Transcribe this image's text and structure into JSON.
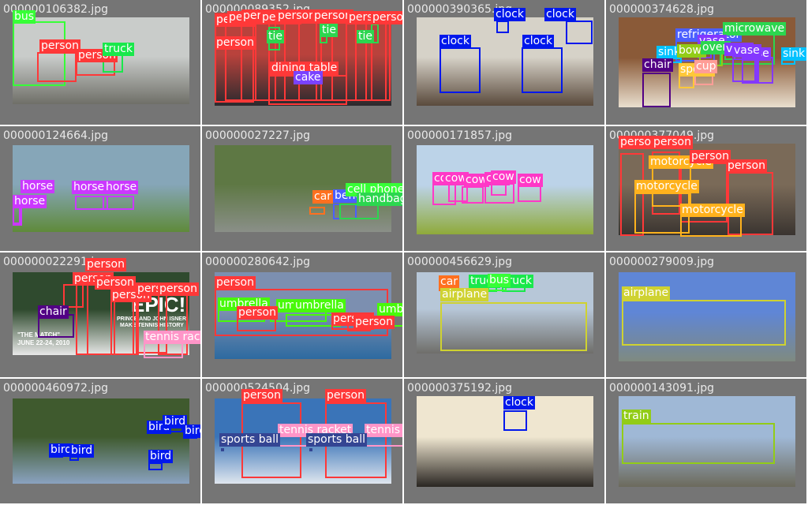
{
  "grid": {
    "cells": [
      {
        "filename": "000000106382.jpg",
        "photo_colors": [
          "#c9ccca",
          "#6f6f68"
        ],
        "detections": [
          {
            "label": "bus",
            "color": "#37ff37"
          },
          {
            "label": "person",
            "color": "#ff3838"
          },
          {
            "label": "person",
            "color": "#ff3838"
          },
          {
            "label": "truck",
            "color": "#19e84b"
          }
        ]
      },
      {
        "filename": "000000089352.jpg",
        "photo_colors": [
          "#b9423c",
          "#2a2a2e"
        ],
        "detections": [
          {
            "label": "person",
            "color": "#ff3838"
          },
          {
            "label": "person",
            "color": "#ff3838"
          },
          {
            "label": "person",
            "color": "#ff3838"
          },
          {
            "label": "person",
            "color": "#ff3838"
          },
          {
            "label": "person",
            "color": "#ff3838"
          },
          {
            "label": "person",
            "color": "#ff3838"
          },
          {
            "label": "person",
            "color": "#ff3838"
          },
          {
            "label": "person",
            "color": "#ff3838"
          },
          {
            "label": "person",
            "color": "#ff3838"
          },
          {
            "label": "tie",
            "color": "#2cd64f"
          },
          {
            "label": "tie",
            "color": "#2cd64f"
          },
          {
            "label": "tie",
            "color": "#2cd64f"
          },
          {
            "label": "dining table",
            "color": "#ff3838"
          },
          {
            "label": "cake",
            "color": "#7a42ff"
          }
        ]
      },
      {
        "filename": "000000390365.jpg",
        "photo_colors": [
          "#d6d2c8",
          "#5a4a3c"
        ],
        "detections": [
          {
            "label": "clock",
            "color": "#0018ec"
          },
          {
            "label": "clock",
            "color": "#0018ec"
          },
          {
            "label": "clock",
            "color": "#0018ec"
          },
          {
            "label": "clock",
            "color": "#0018ec"
          }
        ]
      },
      {
        "filename": "000000374628.jpg",
        "photo_colors": [
          "#8a5a38",
          "#e9dfcf"
        ],
        "detections": [
          {
            "label": "refrigerator",
            "color": "#4b5fff"
          },
          {
            "label": "microwave",
            "color": "#2cd64f"
          },
          {
            "label": "vase",
            "color": "#8438ff"
          },
          {
            "label": "sink",
            "color": "#00c2ff"
          },
          {
            "label": "bowl",
            "color": "#92cc17"
          },
          {
            "label": "oven",
            "color": "#2cd64f"
          },
          {
            "label": "vase",
            "color": "#8438ff"
          },
          {
            "label": "vase",
            "color": "#8438ff"
          },
          {
            "label": "chair",
            "color": "#520085"
          },
          {
            "label": "spoon",
            "color": "#ffc839"
          },
          {
            "label": "cup",
            "color": "#ff9d97"
          },
          {
            "label": "vase",
            "color": "#8438ff"
          },
          {
            "label": "sink",
            "color": "#00c2ff"
          }
        ]
      },
      {
        "filename": "000000124664.jpg",
        "photo_colors": [
          "#86a6b8",
          "#5f8a3a"
        ],
        "detections": [
          {
            "label": "horse",
            "color": "#cb38ff"
          },
          {
            "label": "horse",
            "color": "#cb38ff"
          },
          {
            "label": "horse",
            "color": "#cb38ff"
          },
          {
            "label": "horse",
            "color": "#cb38ff"
          }
        ]
      },
      {
        "filename": "000000027227.jpg",
        "photo_colors": [
          "#5e7844",
          "#8a8f88"
        ],
        "detections": [
          {
            "label": "car",
            "color": "#ff701f"
          },
          {
            "label": "bench",
            "color": "#4b5fff"
          },
          {
            "label": "cell phone",
            "color": "#37ff37"
          },
          {
            "label": "handbag",
            "color": "#2cd64f"
          }
        ]
      },
      {
        "filename": "000000171857.jpg",
        "photo_colors": [
          "#bcd3e8",
          "#8faa3a"
        ],
        "detections": [
          {
            "label": "cow",
            "color": "#ff38c7"
          },
          {
            "label": "cow",
            "color": "#ff38c7"
          },
          {
            "label": "cow",
            "color": "#ff38c7"
          },
          {
            "label": "cow",
            "color": "#ff38c7"
          },
          {
            "label": "cow",
            "color": "#ff38c7"
          },
          {
            "label": "cow",
            "color": "#ff38c7"
          }
        ]
      },
      {
        "filename": "000000377049.jpg",
        "photo_colors": [
          "#7a6a58",
          "#3a3430"
        ],
        "detections": [
          {
            "label": "person",
            "color": "#ff3838"
          },
          {
            "label": "person",
            "color": "#ff3838"
          },
          {
            "label": "motorcycle",
            "color": "#ffb21d"
          },
          {
            "label": "person",
            "color": "#ff3838"
          },
          {
            "label": "person",
            "color": "#ff3838"
          },
          {
            "label": "motorcycle",
            "color": "#ffb21d"
          },
          {
            "label": "motorcycle",
            "color": "#ffb21d"
          }
        ]
      },
      {
        "filename": "000000022291.jpg",
        "photo_colors": [
          "#2f4a2e",
          "#e8e8e8"
        ],
        "overlay_text": [
          "EPIC!",
          "PRINCE AND JOHN ISNER",
          "MAKE TENNIS HISTORY",
          "\"THE MATCH\"",
          "JUNE 22-24, 2010"
        ],
        "detections": [
          {
            "label": "person",
            "color": "#ff3838"
          },
          {
            "label": "person",
            "color": "#ff3838"
          },
          {
            "label": "person",
            "color": "#ff3838"
          },
          {
            "label": "person",
            "color": "#ff3838"
          },
          {
            "label": "person",
            "color": "#ff3838"
          },
          {
            "label": "person",
            "color": "#ff3838"
          },
          {
            "label": "chair",
            "color": "#520085"
          },
          {
            "label": "tennis racket",
            "color": "#ff95c8"
          }
        ]
      },
      {
        "filename": "000000280642.jpg",
        "photo_colors": [
          "#7c8fb0",
          "#2d6aa0"
        ],
        "detections": [
          {
            "label": "person",
            "color": "#ff3838"
          },
          {
            "label": "umbrella",
            "color": "#48f90a"
          },
          {
            "label": "umbrella",
            "color": "#48f90a"
          },
          {
            "label": "person",
            "color": "#ff3838"
          },
          {
            "label": "umbrella",
            "color": "#48f90a"
          },
          {
            "label": "umbrella",
            "color": "#48f90a"
          },
          {
            "label": "person",
            "color": "#ff3838"
          },
          {
            "label": "person",
            "color": "#ff3838"
          }
        ]
      },
      {
        "filename": "000000456629.jpg",
        "photo_colors": [
          "#b7c7d8",
          "#6f6e6a"
        ],
        "detections": [
          {
            "label": "car",
            "color": "#ff701f"
          },
          {
            "label": "truck",
            "color": "#19e84b"
          },
          {
            "label": "truck",
            "color": "#19e84b"
          },
          {
            "label": "bus",
            "color": "#37ff37"
          },
          {
            "label": "airplane",
            "color": "#cfd231"
          }
        ]
      },
      {
        "filename": "000000279009.jpg",
        "photo_colors": [
          "#5f86d6",
          "#7f8a80"
        ],
        "detections": [
          {
            "label": "airplane",
            "color": "#cfd231"
          }
        ]
      },
      {
        "filename": "000000460972.jpg",
        "photo_colors": [
          "#3f5a2e",
          "#8aa2c0"
        ],
        "detections": [
          {
            "label": "bird",
            "color": "#0018ec"
          },
          {
            "label": "bird",
            "color": "#0018ec"
          },
          {
            "label": "bird",
            "color": "#0018ec"
          },
          {
            "label": "bird",
            "color": "#0018ec"
          },
          {
            "label": "bird",
            "color": "#0018ec"
          },
          {
            "label": "bird",
            "color": "#0018ec"
          }
        ]
      },
      {
        "filename": "000000524504.jpg",
        "photo_colors": [
          "#3a74b8",
          "#dfe6ee"
        ],
        "detections": [
          {
            "label": "person",
            "color": "#ff3838"
          },
          {
            "label": "person",
            "color": "#ff3838"
          },
          {
            "label": "tennis racket",
            "color": "#ff95c8"
          },
          {
            "label": "tennis racket",
            "color": "#ff95c8"
          },
          {
            "label": "sports ball",
            "color": "#344593"
          },
          {
            "label": "sports ball",
            "color": "#344593"
          }
        ]
      },
      {
        "filename": "000000375192.jpg",
        "photo_colors": [
          "#efe6d0",
          "#2a2622"
        ],
        "detections": [
          {
            "label": "clock",
            "color": "#0018ec"
          }
        ]
      },
      {
        "filename": "000000143091.jpg",
        "photo_colors": [
          "#9fb8d6",
          "#6c6a5c"
        ],
        "detections": [
          {
            "label": "train",
            "color": "#92cc17"
          }
        ]
      }
    ]
  }
}
